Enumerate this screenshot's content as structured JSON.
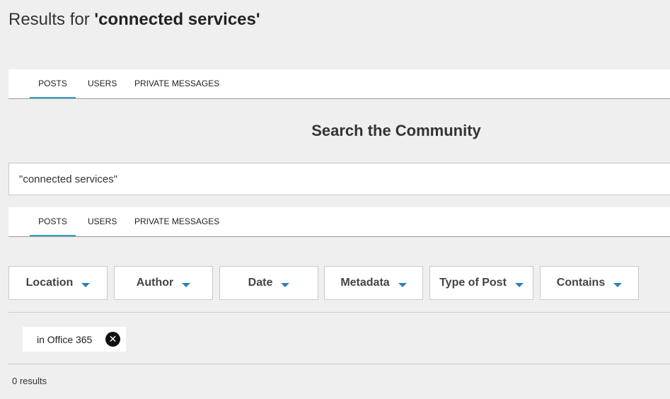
{
  "header": {
    "results_prefix": "Results for ",
    "query": "'connected services'"
  },
  "tabs_top": [
    "POSTS",
    "USERS",
    "PRIVATE MESSAGES"
  ],
  "search": {
    "title": "Search the Community",
    "value": "\"connected services\""
  },
  "tabs_bottom": [
    "POSTS",
    "USERS",
    "PRIVATE MESSAGES"
  ],
  "filters": [
    "Location",
    "Author",
    "Date",
    "Metadata",
    "Type of Post",
    "Contains"
  ],
  "active_filter": {
    "label": "in Office 365",
    "remove_icon": "close-circle-icon"
  },
  "results": {
    "count_text": "0 results"
  },
  "colors": {
    "accent": "#3ca3c4",
    "caret": "#2b7fc2"
  }
}
